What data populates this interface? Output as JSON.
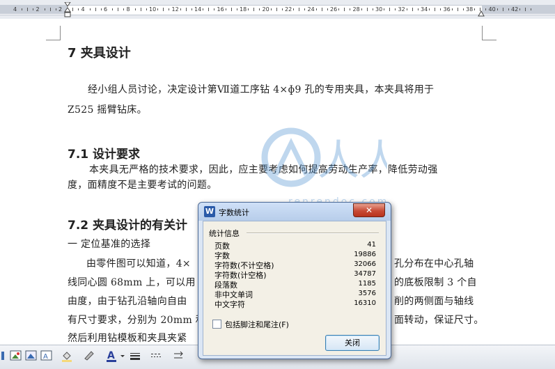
{
  "ruler": {
    "numbers": [
      "4",
      "2",
      "2",
      "4",
      "6",
      "8",
      "10",
      "12",
      "14",
      "16",
      "18",
      "20",
      "22",
      "24",
      "26",
      "28",
      "30",
      "32",
      "34",
      "36",
      "38",
      "40",
      "42"
    ]
  },
  "document": {
    "heading1": "7  夹具设计",
    "para1_line1": "经小组人员讨论，决定设计第Ⅶ道工序钻 4×ɸ9 孔的专用夹具，本夹具将用于",
    "para1_line2": "Z525 摇臂钻床。",
    "heading2": "7.1 设计要求",
    "para2_line1": "本夹具无严格的技术要求，因此，应主要考虑如何提高劳动生产率，降低劳动强",
    "para2_line2": "度，面精度不是主要考试的问题。",
    "heading3": "7.2 夹具设计的有关计",
    "sub1": "一   定位基准的选择",
    "para3_line1_left": "由零件图可以知道，4×",
    "para3_line1_right": "孔分布在中心孔轴",
    "para3_line2_left": "线同心圆 68mm 上，可以用",
    "para3_line2_right": "的底板限制 3 个自",
    "para3_line3_left": "由度，由于钻孔沿轴向自由",
    "para3_line3_right": "削的两侧面与轴线",
    "para3_line4_left": "有尺寸要求，分别为 20mm 和",
    "para3_line4_right": "面转动，保证尺寸。",
    "para3_line5_left": "然后利用钻模板和夹具夹紧"
  },
  "watermark": {
    "text": "人人文库",
    "url": "renrendoc.com"
  },
  "dialog": {
    "title": "字数统计",
    "close_glyph": "✕",
    "group_label": "统计信息",
    "stats": [
      {
        "label": "页数",
        "value": "41"
      },
      {
        "label": "字数",
        "value": "19886"
      },
      {
        "label": "字符数(不计空格)",
        "value": "32066"
      },
      {
        "label": "字符数(计空格)",
        "value": "34787"
      },
      {
        "label": "段落数",
        "value": "1185"
      },
      {
        "label": "非中文单词",
        "value": "3576"
      },
      {
        "label": "中文字符",
        "value": "16310"
      }
    ],
    "checkbox_label": "包括脚注和尾注(F)",
    "close_button": "关闭"
  },
  "colors": {
    "accent": "#3c7fb1",
    "dialog_bg": "#dbe6f4",
    "close_red": "#c74a35"
  }
}
